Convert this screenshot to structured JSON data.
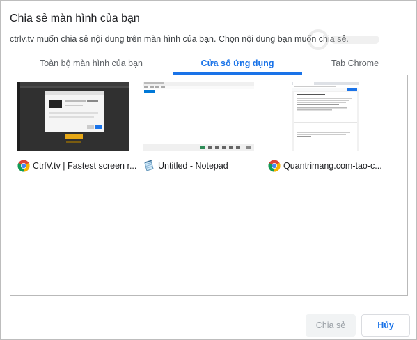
{
  "dialog": {
    "title": "Chia sẻ màn hình của bạn",
    "subtitle": "ctrlv.tv muốn chia sẻ nội dung trên màn hình của bạn. Chọn nội dung bạn muốn chia sẻ."
  },
  "tabs": [
    {
      "label": "Toàn bộ màn hình của bạn",
      "selected": false
    },
    {
      "label": "Cửa sổ ứng dụng",
      "selected": true
    },
    {
      "label": "Tab Chrome",
      "selected": false
    }
  ],
  "windows": [
    {
      "title": "CtrlV.tv | Fastest screen r...",
      "icon": "chrome-icon"
    },
    {
      "title": "Untitled - Notepad",
      "icon": "notepad-icon"
    },
    {
      "title": "Quantrimang.com-tao-c...",
      "icon": "chrome-icon"
    }
  ],
  "buttons": {
    "share_label": "Chia sẻ",
    "cancel_label": "Hủy"
  },
  "colors": {
    "accent": "#1a73e8",
    "disabled_bg": "#f1f3f4",
    "disabled_text": "#9aa0a6"
  }
}
